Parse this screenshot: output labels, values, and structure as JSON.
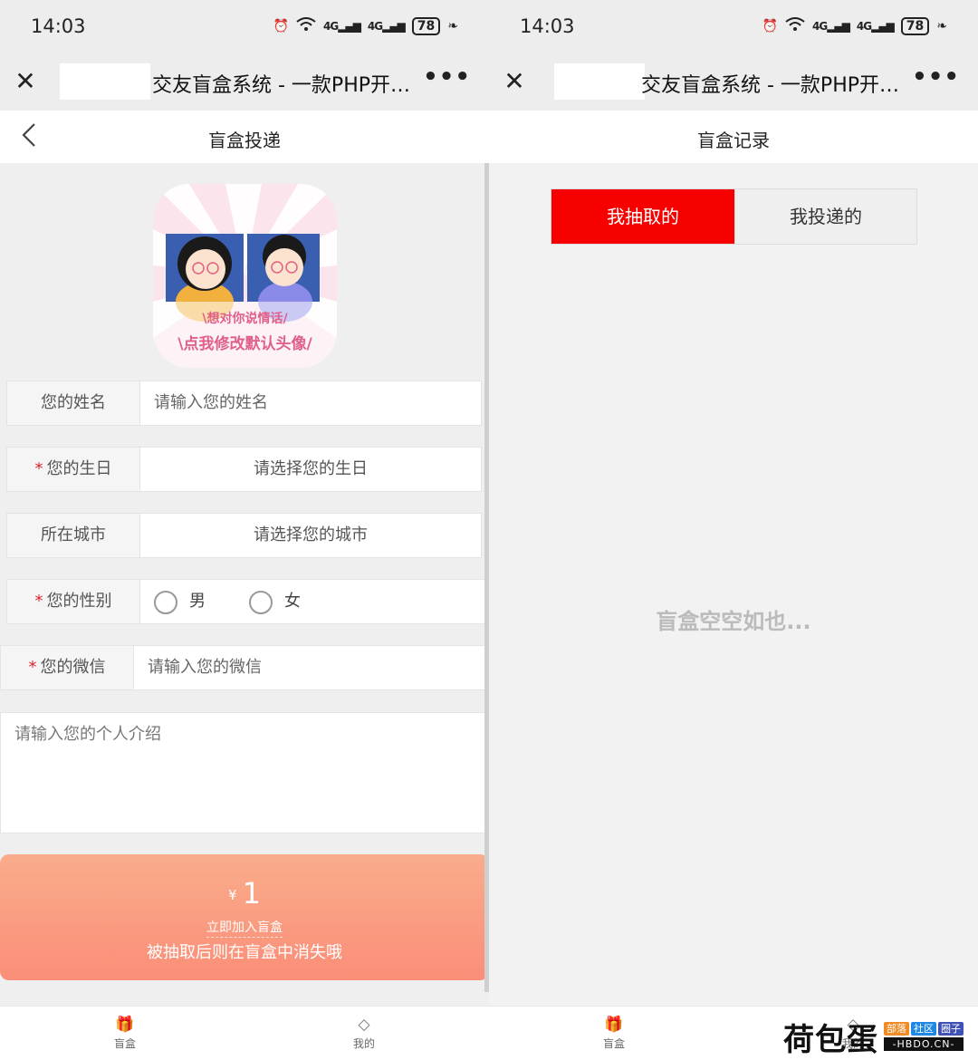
{
  "status": {
    "time": "14:03",
    "net1": "4G",
    "net2": "4G",
    "battery": "78"
  },
  "browser": {
    "title": "交友盲盒系统 - 一款PHP开…",
    "more": "•••"
  },
  "left": {
    "page_title": "盲盒投递",
    "avatar": {
      "line1": "\\想对你说情话/",
      "line2": "\\点我修改默认头像/"
    },
    "form": {
      "name_label": "您的姓名",
      "name_placeholder": "请输入您的姓名",
      "birthday_required": "*",
      "birthday_label": "您的生日",
      "birthday_placeholder": "请选择您的生日",
      "city_label": "所在城市",
      "city_placeholder": "请选择您的城市",
      "gender_required": "*",
      "gender_label": "您的性别",
      "gender_male": "男",
      "gender_female": "女",
      "wechat_required": "*",
      "wechat_label": "您的微信",
      "wechat_placeholder": "请输入您的微信",
      "intro_placeholder": "请输入您的个人介绍"
    },
    "pay": {
      "currency": "¥",
      "amount": "1",
      "line1": "立即加入盲盒",
      "line2": "被抽取后则在盲盒中消失哦"
    }
  },
  "right": {
    "page_title": "盲盒记录",
    "tabs": [
      "我抽取的",
      "我投递的"
    ],
    "active_tab": "我抽取的",
    "empty_text": "盲盒空空如也..."
  },
  "tabbar": {
    "home": "盲盒",
    "mine": "我的"
  },
  "watermark": {
    "main": "荷包蛋",
    "tags": [
      "部落",
      "社区",
      "圈子"
    ],
    "url": "-HBDO.CN-"
  },
  "colors": {
    "accent_red": "#f70000",
    "pay_gradient_top": "#f9ac8b",
    "pay_gradient_bottom": "#fb8e78",
    "required": "#d9232e"
  }
}
